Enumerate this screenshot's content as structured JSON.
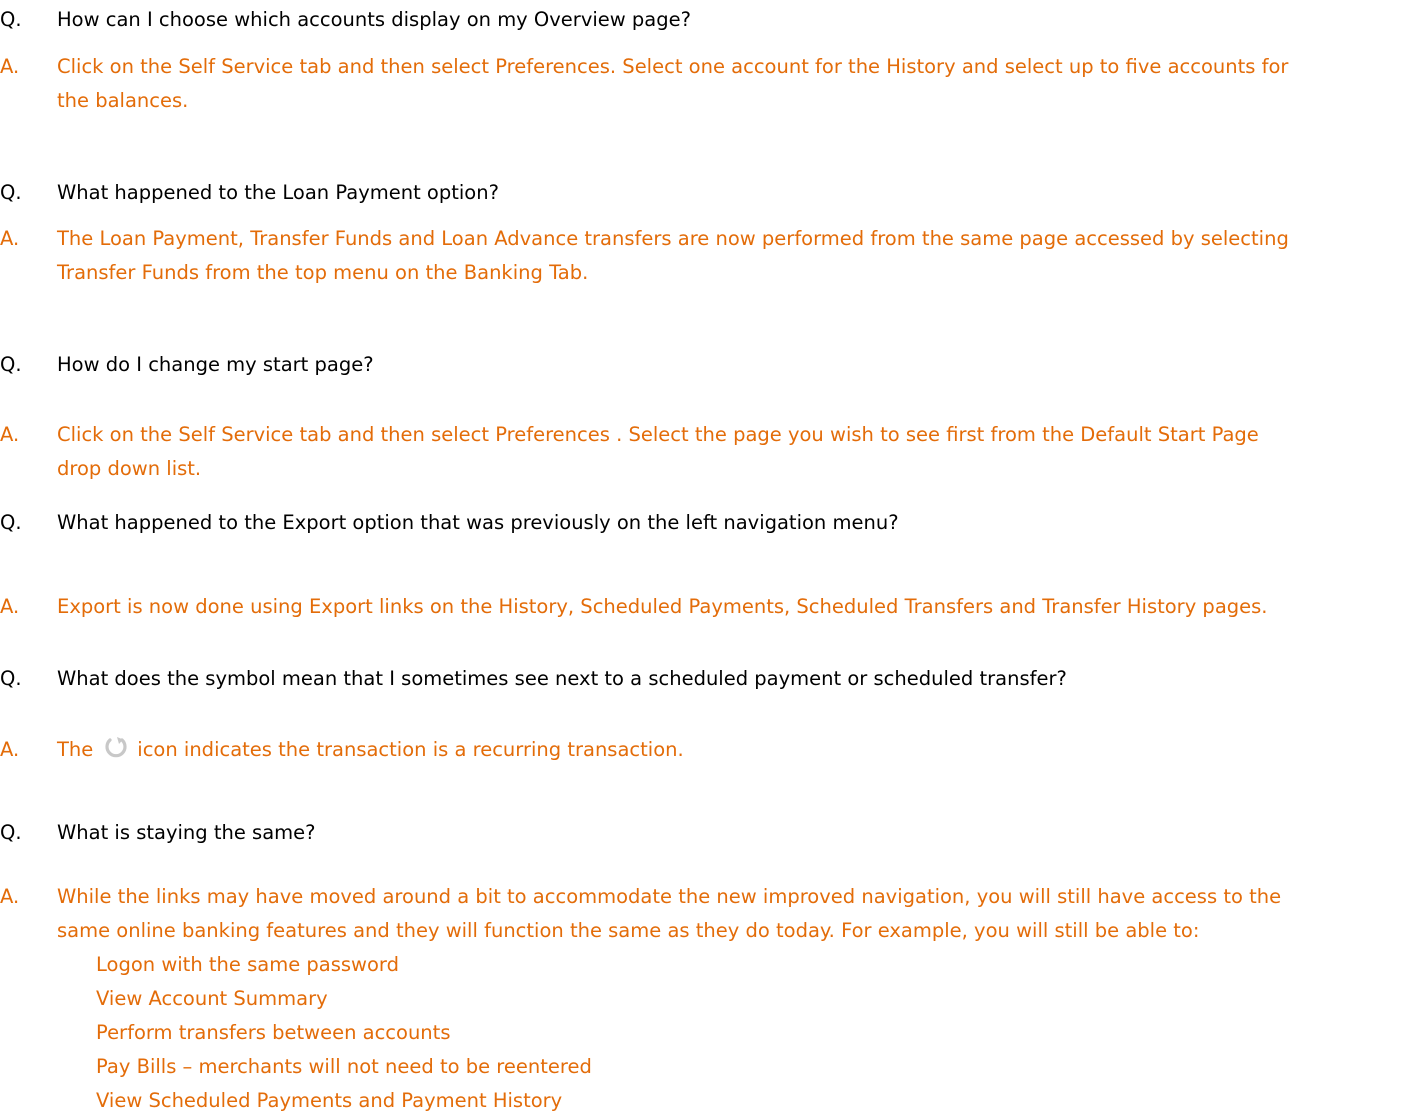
{
  "faq": [
    {
      "q_marker": "Q.",
      "q": "How can I choose which accounts display on my Overview page?",
      "a_marker": "A.",
      "a_lines": [
        "Click on the Self Service tab and then select Preferences. Select one account for the History and select up to five accounts for",
        "the balances."
      ]
    },
    {
      "q_marker": "Q.",
      "q": "What happened to the Loan Payment option?",
      "a_marker": "A.",
      "a_lines": [
        "The Loan Payment, Transfer Funds and Loan Advance transfers are now performed from the same page accessed by selecting",
        "Transfer Funds from the top menu on the Banking Tab."
      ]
    },
    {
      "q_marker": "Q.",
      "q": "How do I change my start page?",
      "a_marker": "A.",
      "a_lines": [
        "Click on the Self Service tab and then select Preferences .  Select the page you wish to see first from the Default Start Page",
        "drop down list."
      ]
    },
    {
      "q_marker": "Q.",
      "q": "What happened to the Export option that was previously on the left navigation menu?",
      "a_marker": "A.",
      "a_lines": [
        "Export is now done using Export links on the History, Scheduled Payments, Scheduled Transfers and Transfer History pages."
      ]
    },
    {
      "q_marker": "Q.",
      "q": "What does the symbol mean that I sometimes see next to a scheduled payment or scheduled transfer?",
      "a_marker": "A.",
      "a_prefix": "The",
      "a_icon": "recurring-icon",
      "a_suffix": "icon indicates the transaction is a recurring transaction."
    },
    {
      "q_marker": "Q.",
      "q": "What is staying the same?",
      "a_marker": "A.",
      "a_lines": [
        "While the links may have moved around a bit to accommodate the new improved navigation, you will still have access to the",
        "same online banking features and they will function the same as they do today. For example, you will still be able to:"
      ],
      "list": [
        "Logon with the same password",
        "View Account Summary",
        "Perform transfers between accounts",
        "Pay Bills – merchants will not need to be reentered",
        "View Scheduled Payments and Payment History"
      ]
    }
  ],
  "colors": {
    "question": "#000000",
    "answer": "#e36c09",
    "icon": "#c8c8c8"
  }
}
